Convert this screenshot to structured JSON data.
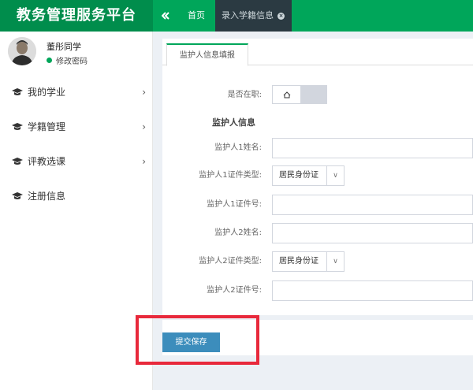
{
  "app": {
    "title": "教务管理服务平台"
  },
  "topnav": {
    "home_label": "首页",
    "active_tab_label": "录入学籍信息"
  },
  "user": {
    "name": "董彤同学",
    "action": "修改密码"
  },
  "sidebar": {
    "items": [
      {
        "label": "我的学业",
        "has_children": true
      },
      {
        "label": "学籍管理",
        "has_children": true
      },
      {
        "label": "评教选课",
        "has_children": true
      },
      {
        "label": "注册信息",
        "has_children": false
      }
    ]
  },
  "form": {
    "tab_label": "监护人信息填报",
    "fields": {
      "employed_label": "是否在职:",
      "section_title": "监护人信息",
      "g1_name_label": "监护人1姓名:",
      "g1_idtype_label": "监护人1证件类型:",
      "g1_idtype_value": "居民身份证",
      "g1_idno_label": "监护人1证件号:",
      "g2_name_label": "监护人2姓名:",
      "g2_idtype_label": "监护人2证件类型:",
      "g2_idtype_value": "居民身份证",
      "g2_idno_label": "监护人2证件号:"
    },
    "submit_label": "提交保存"
  },
  "colors": {
    "brand_green": "#00a65a",
    "logo_green": "#008d4c",
    "submit_blue": "#3c8dbc",
    "highlight_red": "#e8293b"
  }
}
